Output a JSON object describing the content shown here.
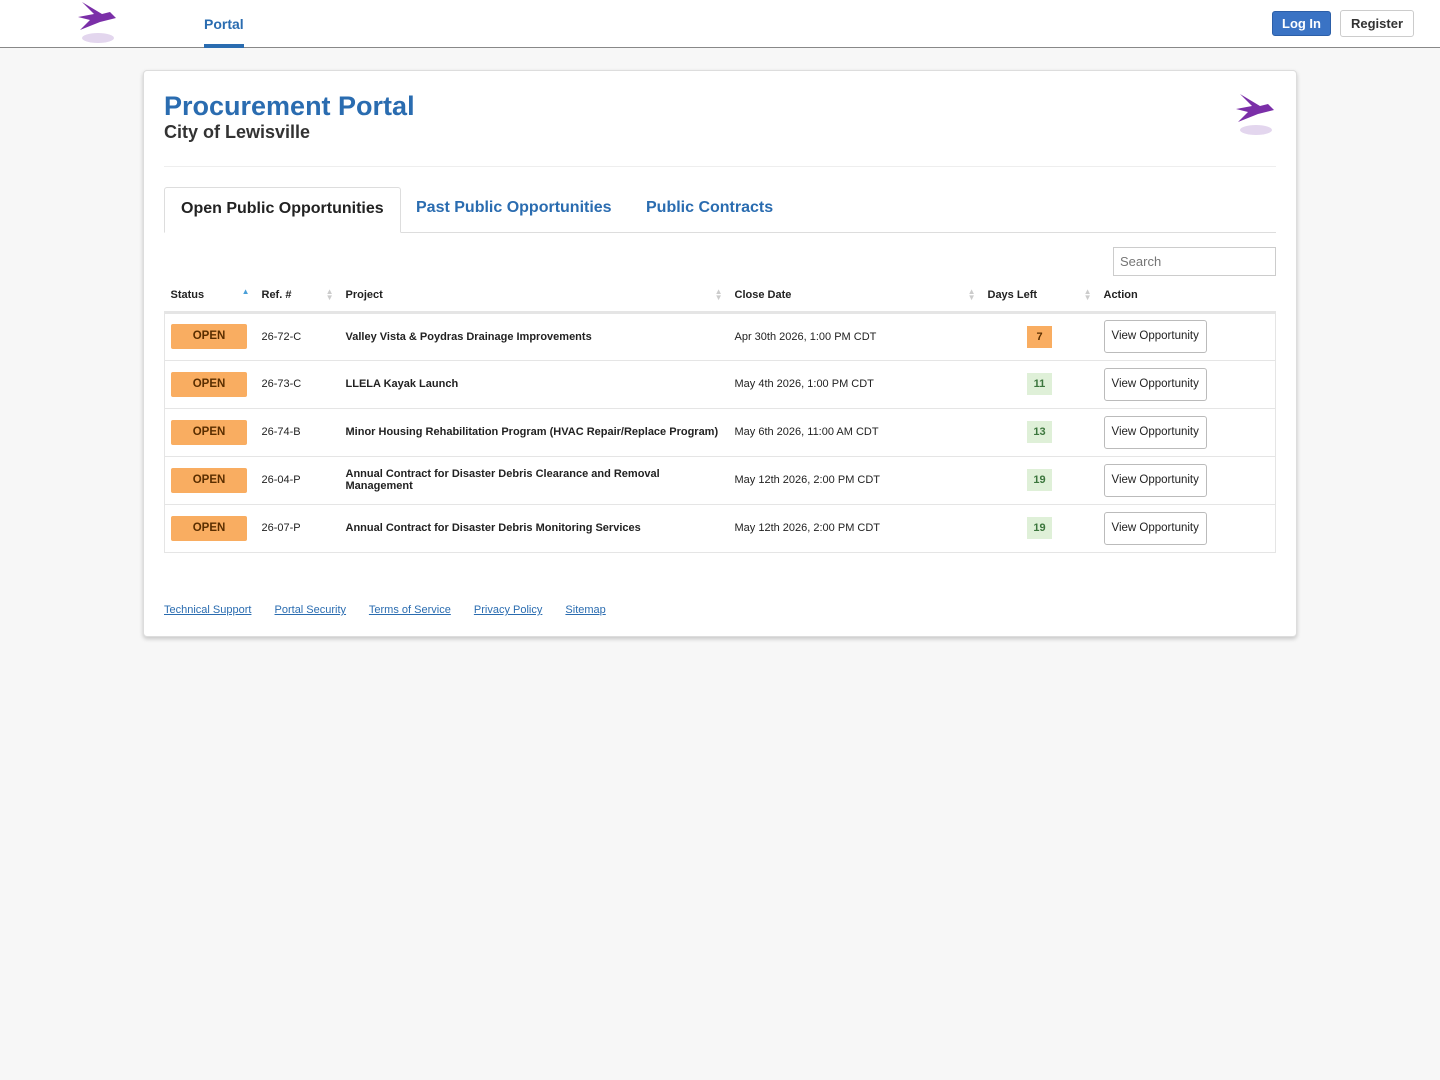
{
  "nav": {
    "tab": "Portal",
    "login": "Log In",
    "register": "Register"
  },
  "header": {
    "title": "Procurement Portal",
    "subtitle": "City of Lewisville"
  },
  "tabs": [
    "Open Public Opportunities",
    "Past Public Opportunities",
    "Public Contracts"
  ],
  "search": {
    "placeholder": "Search"
  },
  "columns": [
    "Status",
    "Ref. #",
    "Project",
    "Close Date",
    "Days Left",
    "Action"
  ],
  "rows": [
    {
      "status": "OPEN",
      "ref": "26-72-C",
      "project": "Valley Vista & Poydras Drainage Improvements",
      "close": "Apr 30th 2026, 1:00 PM CDT",
      "days": "7",
      "action": "View Opportunity"
    },
    {
      "status": "OPEN",
      "ref": "26-73-C",
      "project": "LLELA Kayak Launch",
      "close": "May 4th 2026, 1:00 PM CDT",
      "days": "11",
      "action": "View Opportunity"
    },
    {
      "status": "OPEN",
      "ref": "26-74-B",
      "project": "Minor Housing Rehabilitation Program (HVAC Repair/Replace Program)",
      "close": "May 6th 2026, 11:00 AM CDT",
      "days": "13",
      "action": "View Opportunity"
    },
    {
      "status": "OPEN",
      "ref": "26-04-P",
      "project": "Annual Contract for Disaster Debris Clearance and Removal Management",
      "close": "May 12th 2026, 2:00 PM CDT",
      "days": "19",
      "action": "View Opportunity"
    },
    {
      "status": "OPEN",
      "ref": "26-07-P",
      "project": "Annual Contract for Disaster Debris Monitoring Services",
      "close": "May 12th 2026, 2:00 PM CDT",
      "days": "19",
      "action": "View Opportunity"
    }
  ],
  "footer": [
    "Technical Support",
    "Portal Security",
    "Terms of Service",
    "Privacy Policy",
    "Sitemap"
  ]
}
